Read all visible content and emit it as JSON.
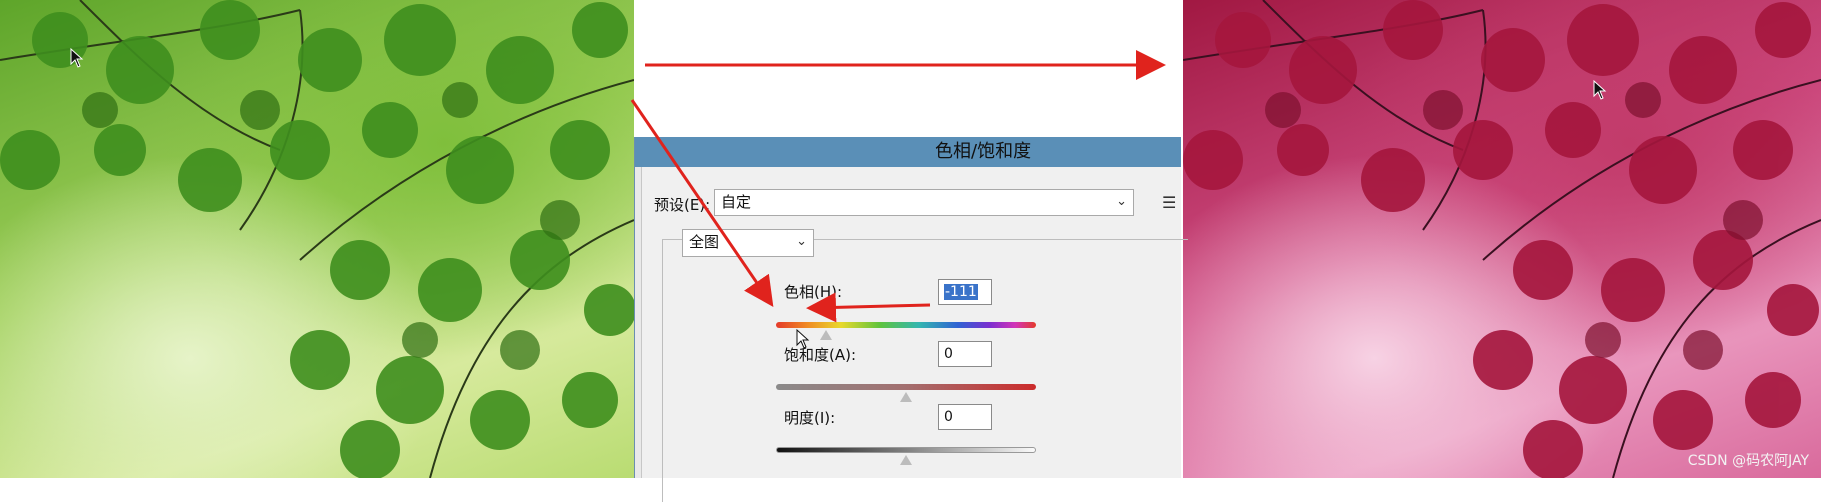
{
  "dialog": {
    "title": "色相/饱和度",
    "preset_label": "预设(E):",
    "preset_value": "自定",
    "channel_value": "全图",
    "hue_label": "色相(H):",
    "hue_value": "-111",
    "saturation_label": "饱和度(A):",
    "saturation_value": "0",
    "lightness_label": "明度(I):",
    "lightness_value": "0",
    "hue_slider_level": -111,
    "saturation_slider_level": 0,
    "lightness_slider_level": 0
  },
  "watermark": "CSDN @码农阿JAY",
  "colors": {
    "titlebar": "#5a8fb7",
    "annotation_arrow": "#e0231d",
    "leaf_green": "#3f8f1e",
    "leaf_red": "#a5163d"
  },
  "icons": {
    "preset_menu": "list-menu-icon",
    "cursor": "move-cursor-icon"
  }
}
